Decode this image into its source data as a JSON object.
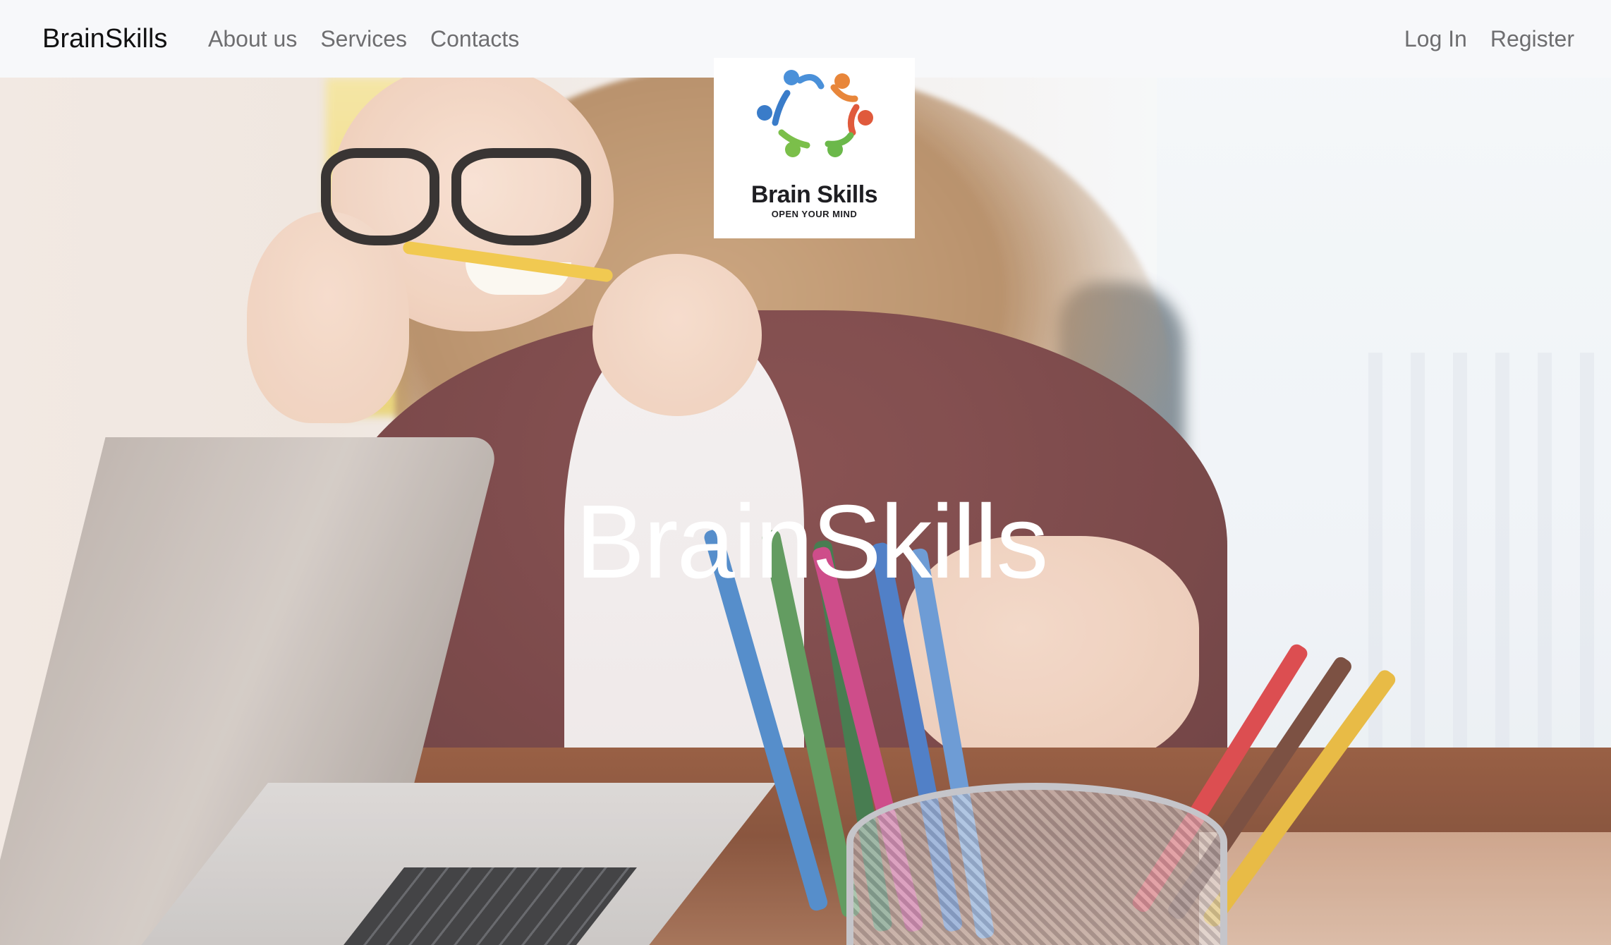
{
  "navbar": {
    "brand": "BrainSkills",
    "links": [
      "About us",
      "Services",
      "Contacts"
    ],
    "auth": {
      "login": "Log In",
      "register": "Register"
    }
  },
  "logo": {
    "name": "Brain Skills",
    "tagline": "OPEN YOUR MIND",
    "figure_colors": [
      "#4a90d9",
      "#e8863a",
      "#e05a3c",
      "#7bbf4a",
      "#3a7cc9",
      "#6bb84a"
    ]
  },
  "hero": {
    "title": "BrainSkills"
  },
  "colors": {
    "navbar_bg": "#f7f8fa",
    "brand_text": "#111111",
    "nav_link": "#6e6e70",
    "hero_title": "#ffffff"
  }
}
